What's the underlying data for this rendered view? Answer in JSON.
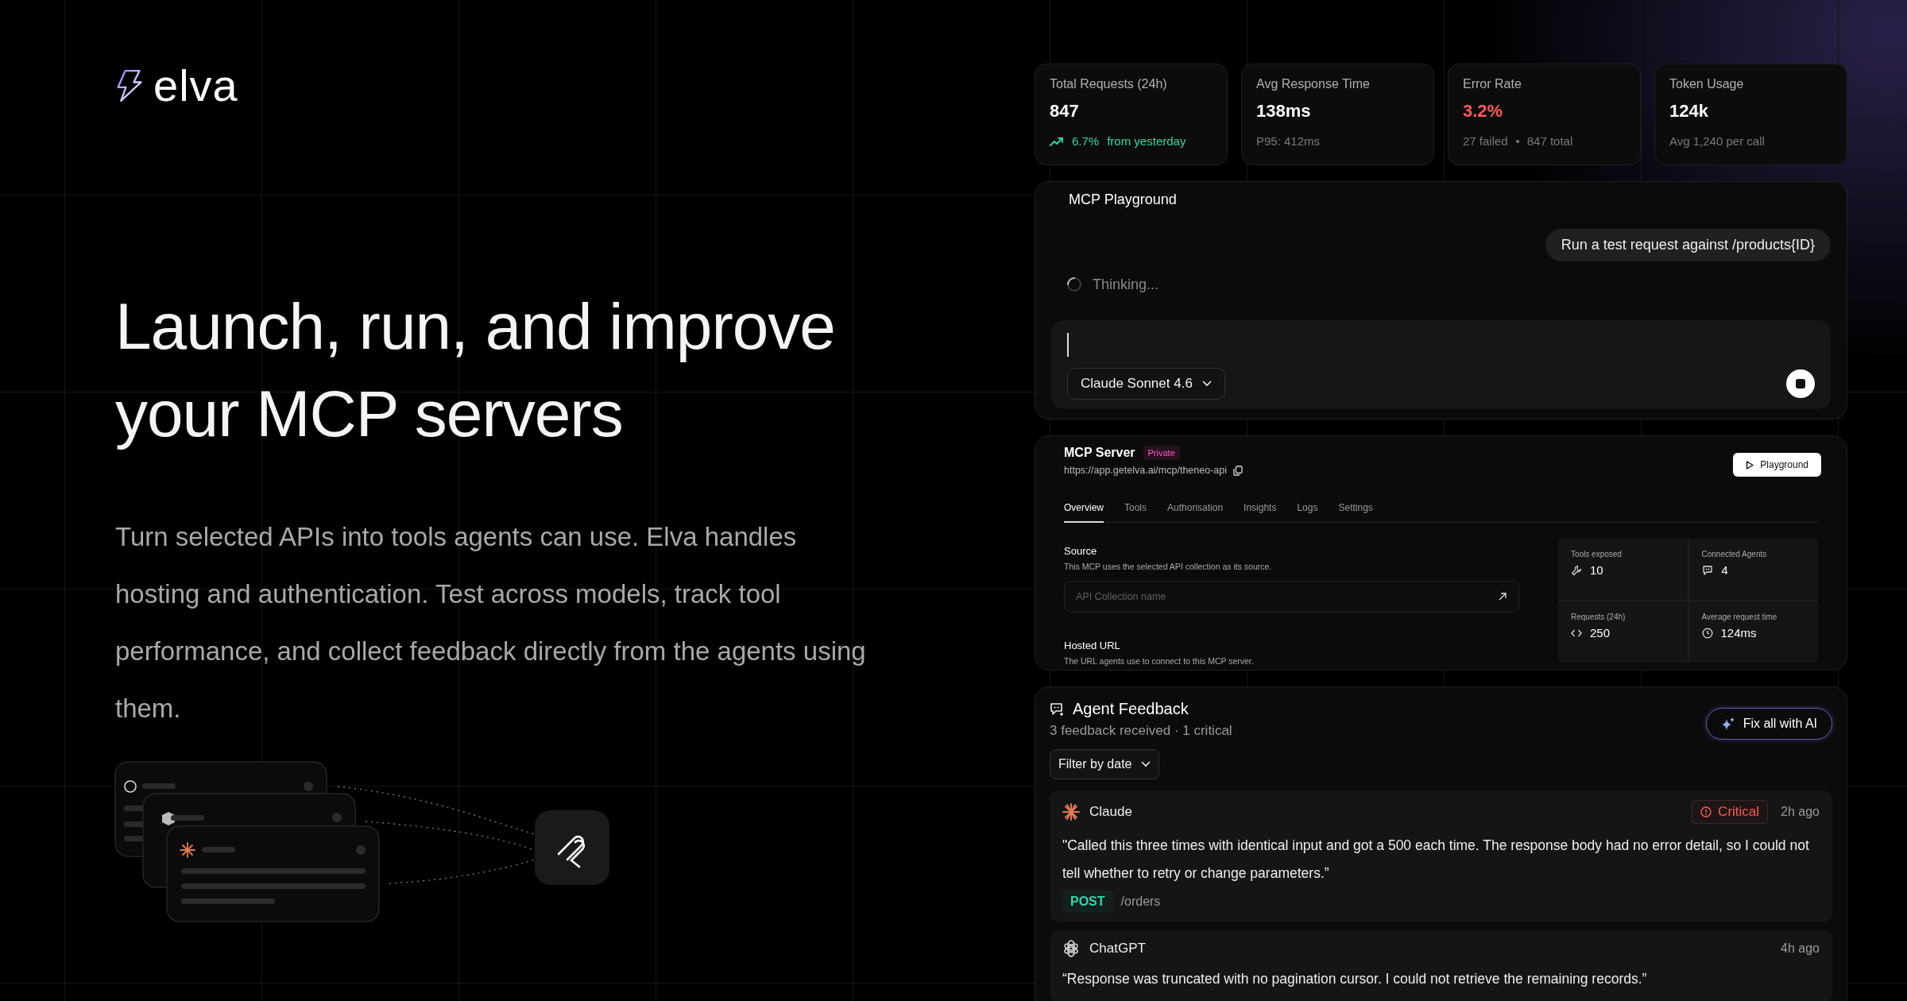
{
  "brand": {
    "name": "elva"
  },
  "hero": {
    "headline": [
      "Launch, run, and improve",
      "your MCP servers"
    ],
    "description": "Turn selected APIs into tools agents can use. Elva handles hosting and authentication. Test across models, track tool performance, and collect feedback directly from the agents using them."
  },
  "stats": [
    {
      "label": "Total Requests (24h)",
      "value": "847",
      "alert": false,
      "trend": "6.7%",
      "details": [
        "from yesterday"
      ]
    },
    {
      "label": "Avg Response Time",
      "value": "138ms",
      "alert": false,
      "details": [
        "P95: 412ms"
      ]
    },
    {
      "label": "Error Rate",
      "value": "3.2%",
      "alert": true,
      "details": [
        "27 failed",
        "847 total"
      ]
    },
    {
      "label": "Token Usage",
      "value": "124k",
      "alert": false,
      "details": [
        "Avg 1,240 per call"
      ]
    }
  ],
  "playground": {
    "title": "MCP Playground",
    "user_message": "Run a test request against /products{ID}",
    "status": "Thinking...",
    "model": "Claude Sonnet 4.6"
  },
  "server": {
    "title": "MCP Server",
    "badge": "Private",
    "url": "https://app.getelva.ai/mcp/theneo-api",
    "action": "Playground",
    "tabs": [
      {
        "label": "Overview",
        "selected": true
      },
      {
        "label": "Tools",
        "selected": false
      },
      {
        "label": "Authorisation",
        "selected": false
      },
      {
        "label": "Insights",
        "selected": false
      },
      {
        "label": "Logs",
        "selected": false
      },
      {
        "label": "Settings",
        "selected": false
      }
    ],
    "source": {
      "title": "Source",
      "description": "This MCP uses the selected API collection as its source.",
      "placeholder": "API Collection name"
    },
    "hosted": {
      "title": "Hosted URL",
      "description": "The URL agents use to connect to this MCP server."
    },
    "metrics": [
      {
        "kind": "tools",
        "label": "Tools exposed",
        "value": "10"
      },
      {
        "kind": "agents",
        "label": "Connected Agents",
        "value": "4"
      },
      {
        "kind": "requests",
        "label": "Requests (24h)",
        "value": "250"
      },
      {
        "kind": "time",
        "label": "Average request time",
        "value": "124ms"
      }
    ]
  },
  "feedback": {
    "title": "Agent Feedback",
    "summary": "3 feedback received · 1 critical",
    "action": "Fix all with AI",
    "filter": "Filter by date",
    "items": [
      {
        "kind": "claude",
        "agent": "Claude",
        "critical": true,
        "severity": "Critical",
        "time": "2h ago",
        "quote": "\"Called this three times with identical input and got a 500 each time. The response body had no error detail, so I could not tell whether to retry or change parameters.”",
        "method": "POST",
        "path": "/orders"
      },
      {
        "kind": "chatgpt",
        "agent": "ChatGPT",
        "critical": false,
        "time": "4h ago",
        "quote": "“Response was truncated with no pagination cursor. I could not retrieve the remaining records.”"
      }
    ]
  }
}
